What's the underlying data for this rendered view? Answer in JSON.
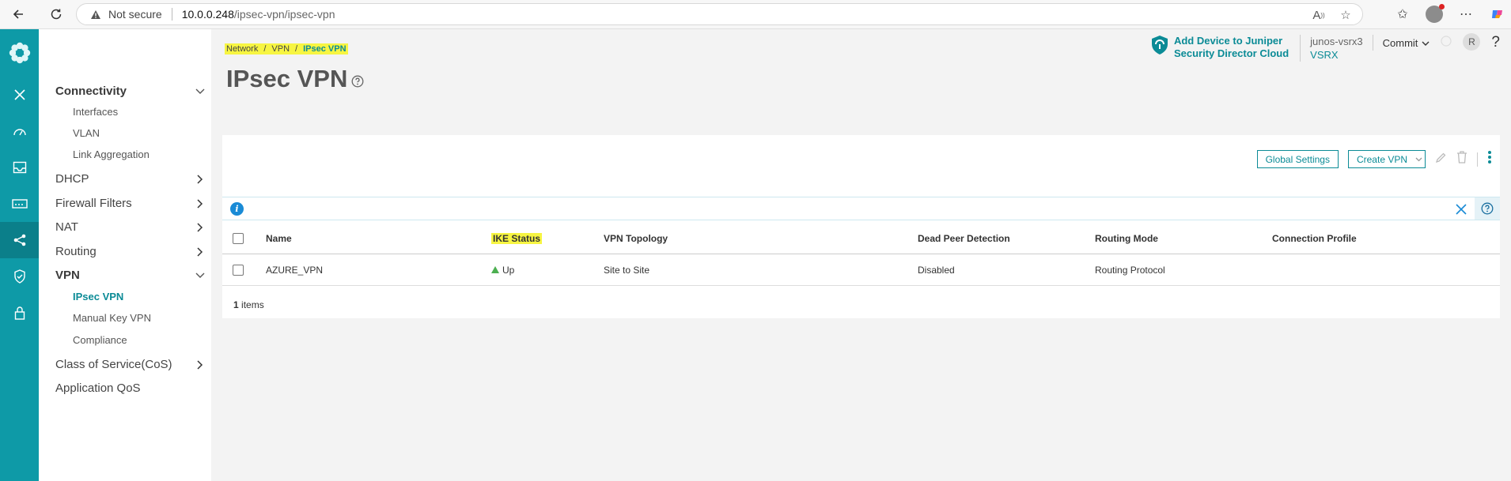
{
  "browser": {
    "security_label": "Not secure",
    "url_host": "10.0.0.248",
    "url_path": "/ipsec-vpn/ipsec-vpn"
  },
  "sidemenu": {
    "connectivity": "Connectivity",
    "interfaces": "Interfaces",
    "vlan": "VLAN",
    "link_aggregation": "Link Aggregation",
    "dhcp": "DHCP",
    "firewall_filters": "Firewall Filters",
    "nat": "NAT",
    "routing": "Routing",
    "vpn": "VPN",
    "ipsec_vpn": "IPsec VPN",
    "manual_key_vpn": "Manual Key VPN",
    "compliance": "Compliance",
    "class_of_service": "Class of Service(CoS)",
    "application_qos": "Application QoS"
  },
  "breadcrumb": {
    "network": "Network",
    "vpn": "VPN",
    "current": "IPsec VPN"
  },
  "page": {
    "title": "IPsec VPN"
  },
  "header": {
    "sdc_line1": "Add Device to Juniper",
    "sdc_line2": "Security Director Cloud",
    "device_name": "junos-vsrx3",
    "device_model": "VSRX",
    "commit_label": "Commit",
    "avatar_letter": "R",
    "help_label": "?"
  },
  "toolbar": {
    "global_settings": "Global Settings",
    "create_vpn": "Create VPN"
  },
  "table": {
    "columns": {
      "name": "Name",
      "ike_status": "IKE Status",
      "vpn_topology": "VPN Topology",
      "dpd": "Dead Peer Detection",
      "routing_mode": "Routing Mode",
      "connection_profile": "Connection Profile"
    },
    "rows": [
      {
        "name": "AZURE_VPN",
        "ike_status": "Up",
        "vpn_topology": "Site to Site",
        "dpd": "Disabled",
        "routing_mode": "Routing Protocol",
        "connection_profile": ""
      }
    ],
    "footer_count": "1",
    "footer_label": "items"
  },
  "colors": {
    "accent": "#0b8b96",
    "rail": "#0e9aa7",
    "highlight": "#f7f542",
    "status_up": "#4caf50"
  }
}
